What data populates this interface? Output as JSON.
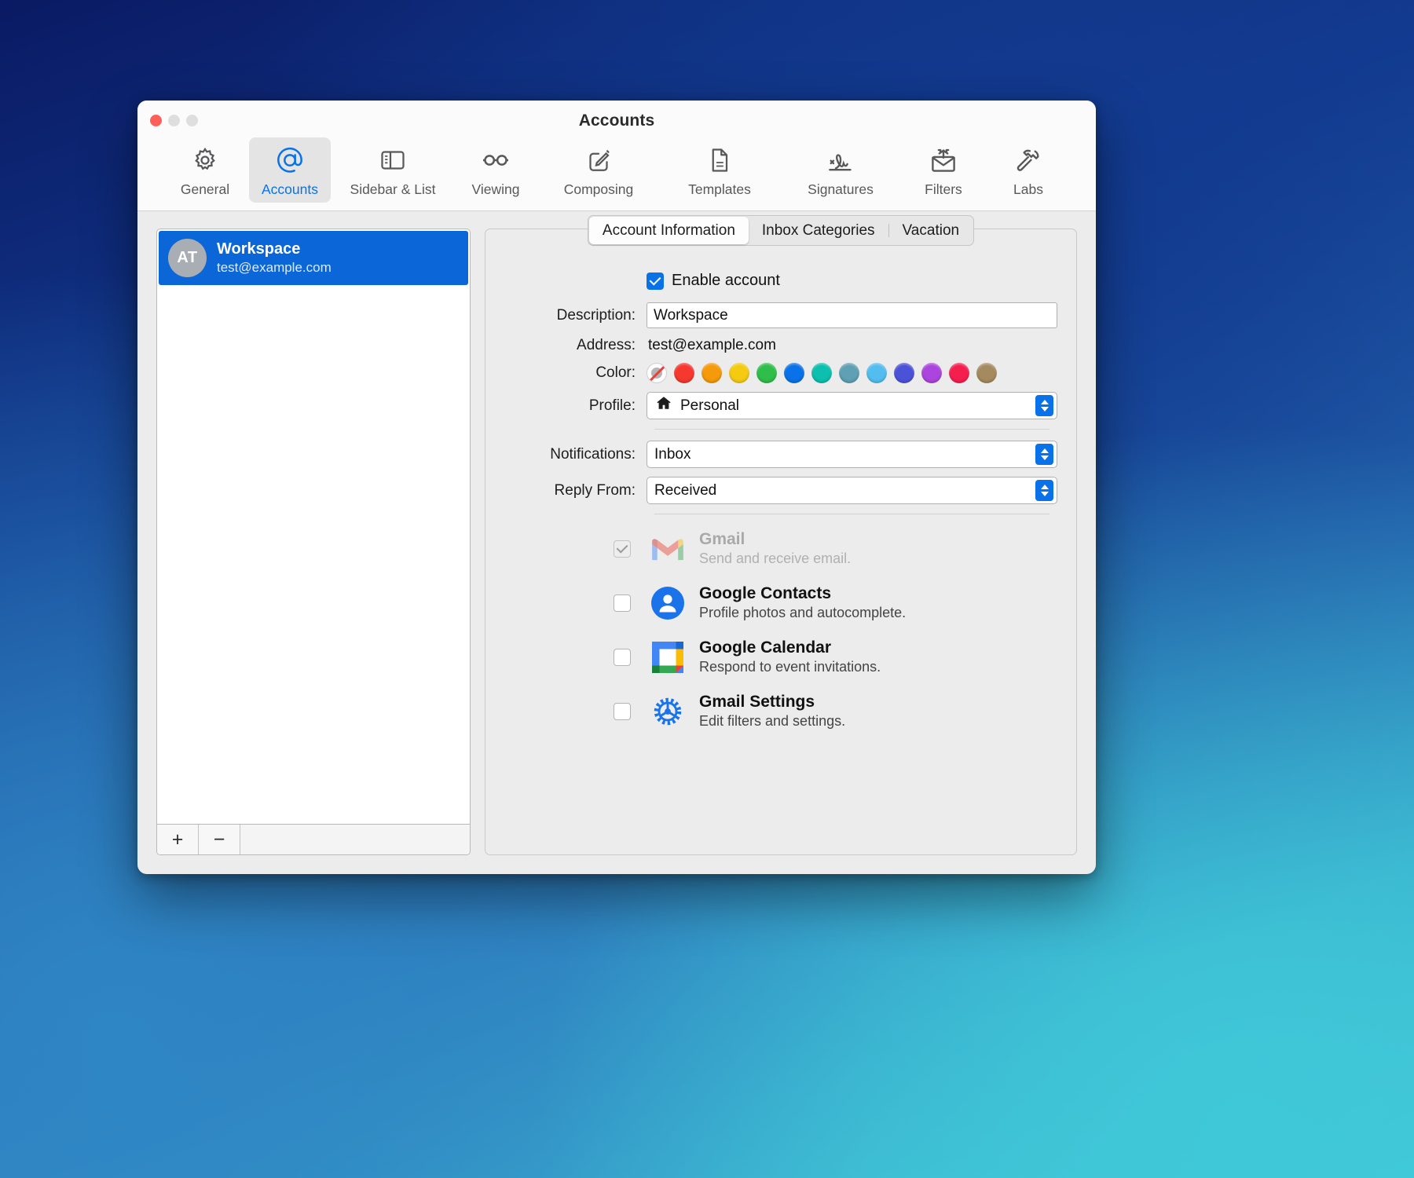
{
  "window": {
    "title": "Accounts",
    "traffic_lights": [
      "close",
      "minimize",
      "zoom"
    ]
  },
  "toolbar": {
    "items": [
      {
        "label": "General",
        "icon": "gear-icon",
        "selected": false
      },
      {
        "label": "Accounts",
        "icon": "at-sign-icon",
        "selected": true
      },
      {
        "label": "Sidebar & List",
        "icon": "sidebar-icon",
        "selected": false
      },
      {
        "label": "Viewing",
        "icon": "glasses-icon",
        "selected": false
      },
      {
        "label": "Composing",
        "icon": "compose-icon",
        "selected": false
      },
      {
        "label": "Templates",
        "icon": "document-icon",
        "selected": false
      },
      {
        "label": "Signatures",
        "icon": "signature-icon",
        "selected": false
      },
      {
        "label": "Filters",
        "icon": "filters-icon",
        "selected": false
      },
      {
        "label": "Labs",
        "icon": "hammer-icon",
        "selected": false
      }
    ]
  },
  "accounts_list": {
    "rows": [
      {
        "initials": "AT",
        "name": "Workspace",
        "email": "test@example.com",
        "selected": true
      }
    ],
    "add_label": "+",
    "remove_label": "−"
  },
  "detail": {
    "tabs": [
      {
        "label": "Account Information",
        "active": true
      },
      {
        "label": "Inbox Categories",
        "active": false
      },
      {
        "label": "Vacation",
        "active": false
      }
    ],
    "enable_account": {
      "label": "Enable account",
      "checked": true
    },
    "fields": {
      "description_label": "Description:",
      "description_value": "Workspace",
      "address_label": "Address:",
      "address_value": "test@example.com",
      "color_label": "Color:",
      "profile_label": "Profile:",
      "profile_value": "Personal",
      "profile_icon": "house-icon",
      "notifications_label": "Notifications:",
      "notifications_value": "Inbox",
      "reply_from_label": "Reply From:",
      "reply_from_value": "Received"
    },
    "colors": [
      {
        "name": "none",
        "hex": "#ffffff"
      },
      {
        "name": "red",
        "hex": "#f5392f"
      },
      {
        "name": "orange",
        "hex": "#f59a0b"
      },
      {
        "name": "yellow",
        "hex": "#f5cb12"
      },
      {
        "name": "green",
        "hex": "#2fbe4a"
      },
      {
        "name": "blue",
        "hex": "#0a72e8"
      },
      {
        "name": "teal",
        "hex": "#0dbfae"
      },
      {
        "name": "steel-blue",
        "hex": "#5fa0b5"
      },
      {
        "name": "light-blue",
        "hex": "#54bdf0"
      },
      {
        "name": "indigo",
        "hex": "#4b52d8"
      },
      {
        "name": "purple",
        "hex": "#ac45dd"
      },
      {
        "name": "pink-red",
        "hex": "#f51f4d"
      },
      {
        "name": "brown",
        "hex": "#a68a5f"
      }
    ],
    "services": [
      {
        "name": "Gmail",
        "description": "Send and receive email.",
        "icon": "gmail-icon",
        "checked": true,
        "disabled": true
      },
      {
        "name": "Google Contacts",
        "description": "Profile photos and autocomplete.",
        "icon": "google-contacts-icon",
        "checked": false,
        "disabled": false
      },
      {
        "name": "Google Calendar",
        "description": "Respond to event invitations.",
        "icon": "google-calendar-icon",
        "checked": false,
        "disabled": false
      },
      {
        "name": "Gmail Settings",
        "description": "Edit filters and settings.",
        "icon": "gmail-settings-icon",
        "checked": false,
        "disabled": false
      }
    ]
  }
}
